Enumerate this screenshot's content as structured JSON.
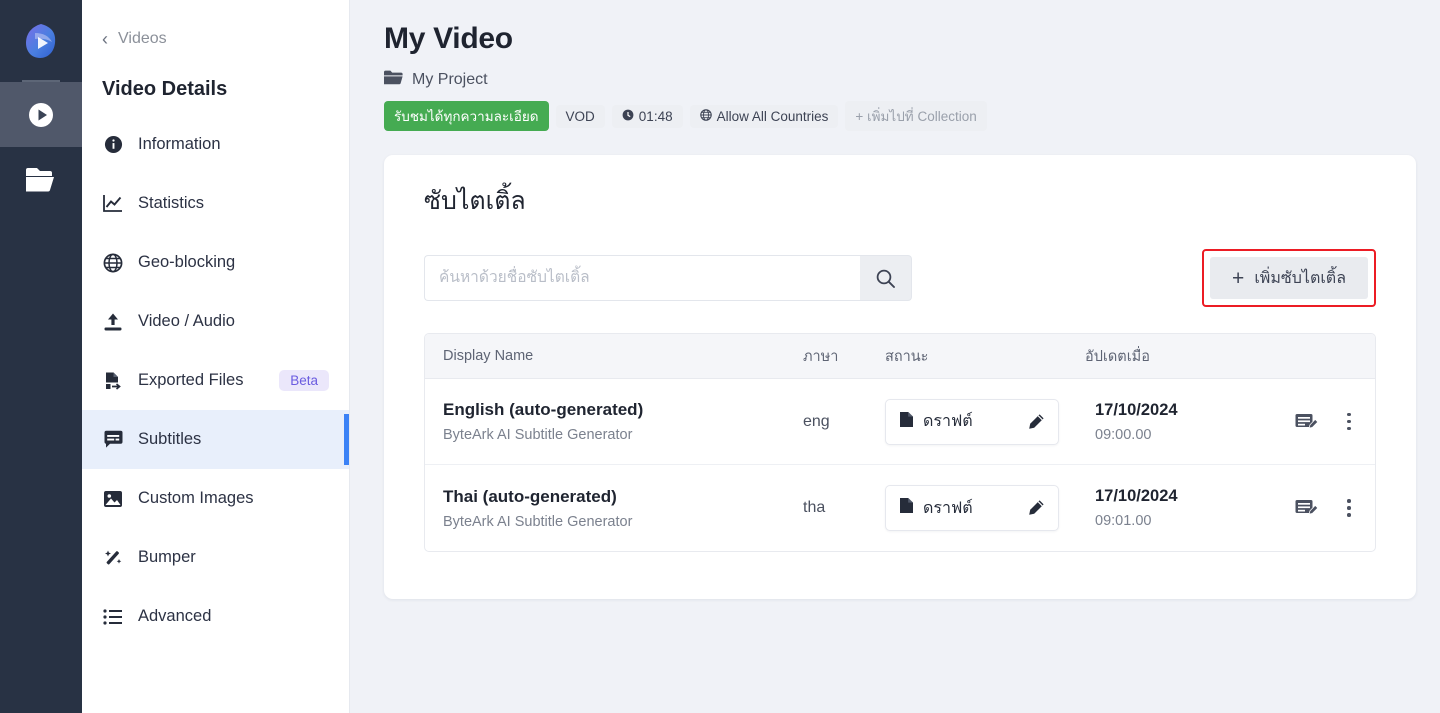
{
  "rail": {
    "logo_name": "bytearc-logo",
    "items": [
      {
        "icon": "play-circle-icon",
        "name": "videos",
        "active": true
      },
      {
        "icon": "folder-icon",
        "name": "projects",
        "active": false
      }
    ]
  },
  "sidebar": {
    "back_label": "Videos",
    "title": "Video Details",
    "items": [
      {
        "label": "Information",
        "icon": "info-icon",
        "badge": ""
      },
      {
        "label": "Statistics",
        "icon": "chart-icon",
        "badge": ""
      },
      {
        "label": "Geo-blocking",
        "icon": "globe-icon",
        "badge": ""
      },
      {
        "label": "Video / Audio",
        "icon": "upload-icon",
        "badge": ""
      },
      {
        "label": "Exported Files",
        "icon": "export-file-icon",
        "badge": "Beta"
      },
      {
        "label": "Subtitles",
        "icon": "subtitles-icon",
        "badge": ""
      },
      {
        "label": "Custom Images",
        "icon": "image-icon",
        "badge": ""
      },
      {
        "label": "Bumper",
        "icon": "wand-icon",
        "badge": ""
      },
      {
        "label": "Advanced",
        "icon": "list-icon",
        "badge": ""
      }
    ],
    "active_index": 5
  },
  "header": {
    "title": "My Video",
    "project": "My Project",
    "chips": [
      {
        "label": "รับชมได้ทุกความละเอียด",
        "style": "green",
        "icon": ""
      },
      {
        "label": "VOD",
        "style": "plain",
        "icon": ""
      },
      {
        "label": "01:48",
        "style": "plain",
        "icon": "clock-icon"
      },
      {
        "label": "Allow All Countries",
        "style": "plain",
        "icon": "globe-small-icon"
      },
      {
        "label": "+ เพิ่มไปที่ Collection",
        "style": "muted",
        "icon": ""
      }
    ]
  },
  "card": {
    "title": "ซับไตเติ้ล",
    "search_placeholder": "ค้นหาด้วยชื่อซับไตเติ้ล",
    "search_value": "",
    "add_button_label": "เพิ่มซับไตเติ้ล",
    "add_button_plus": "+",
    "columns": [
      "Display Name",
      "ภาษา",
      "สถานะ",
      "อัปเดตเมื่อ"
    ],
    "rows": [
      {
        "name": "English (auto-generated)",
        "source": "ByteArk AI Subtitle Generator",
        "lang": "eng",
        "status": "ดราฟต์",
        "date": "17/10/2024",
        "time": "09:00.00"
      },
      {
        "name": "Thai (auto-generated)",
        "source": "ByteArk AI Subtitle Generator",
        "lang": "tha",
        "status": "ดราฟต์",
        "date": "17/10/2024",
        "time": "09:01.00"
      }
    ]
  },
  "colors": {
    "rail_bg": "#283244",
    "rail_active": "#50586a",
    "page_bg": "#f0f2f7",
    "accent_blue": "#3b82f6",
    "green_badge": "#45ab52",
    "beta_purple": "#6b5ce0",
    "highlight_red": "#ec1c24"
  }
}
